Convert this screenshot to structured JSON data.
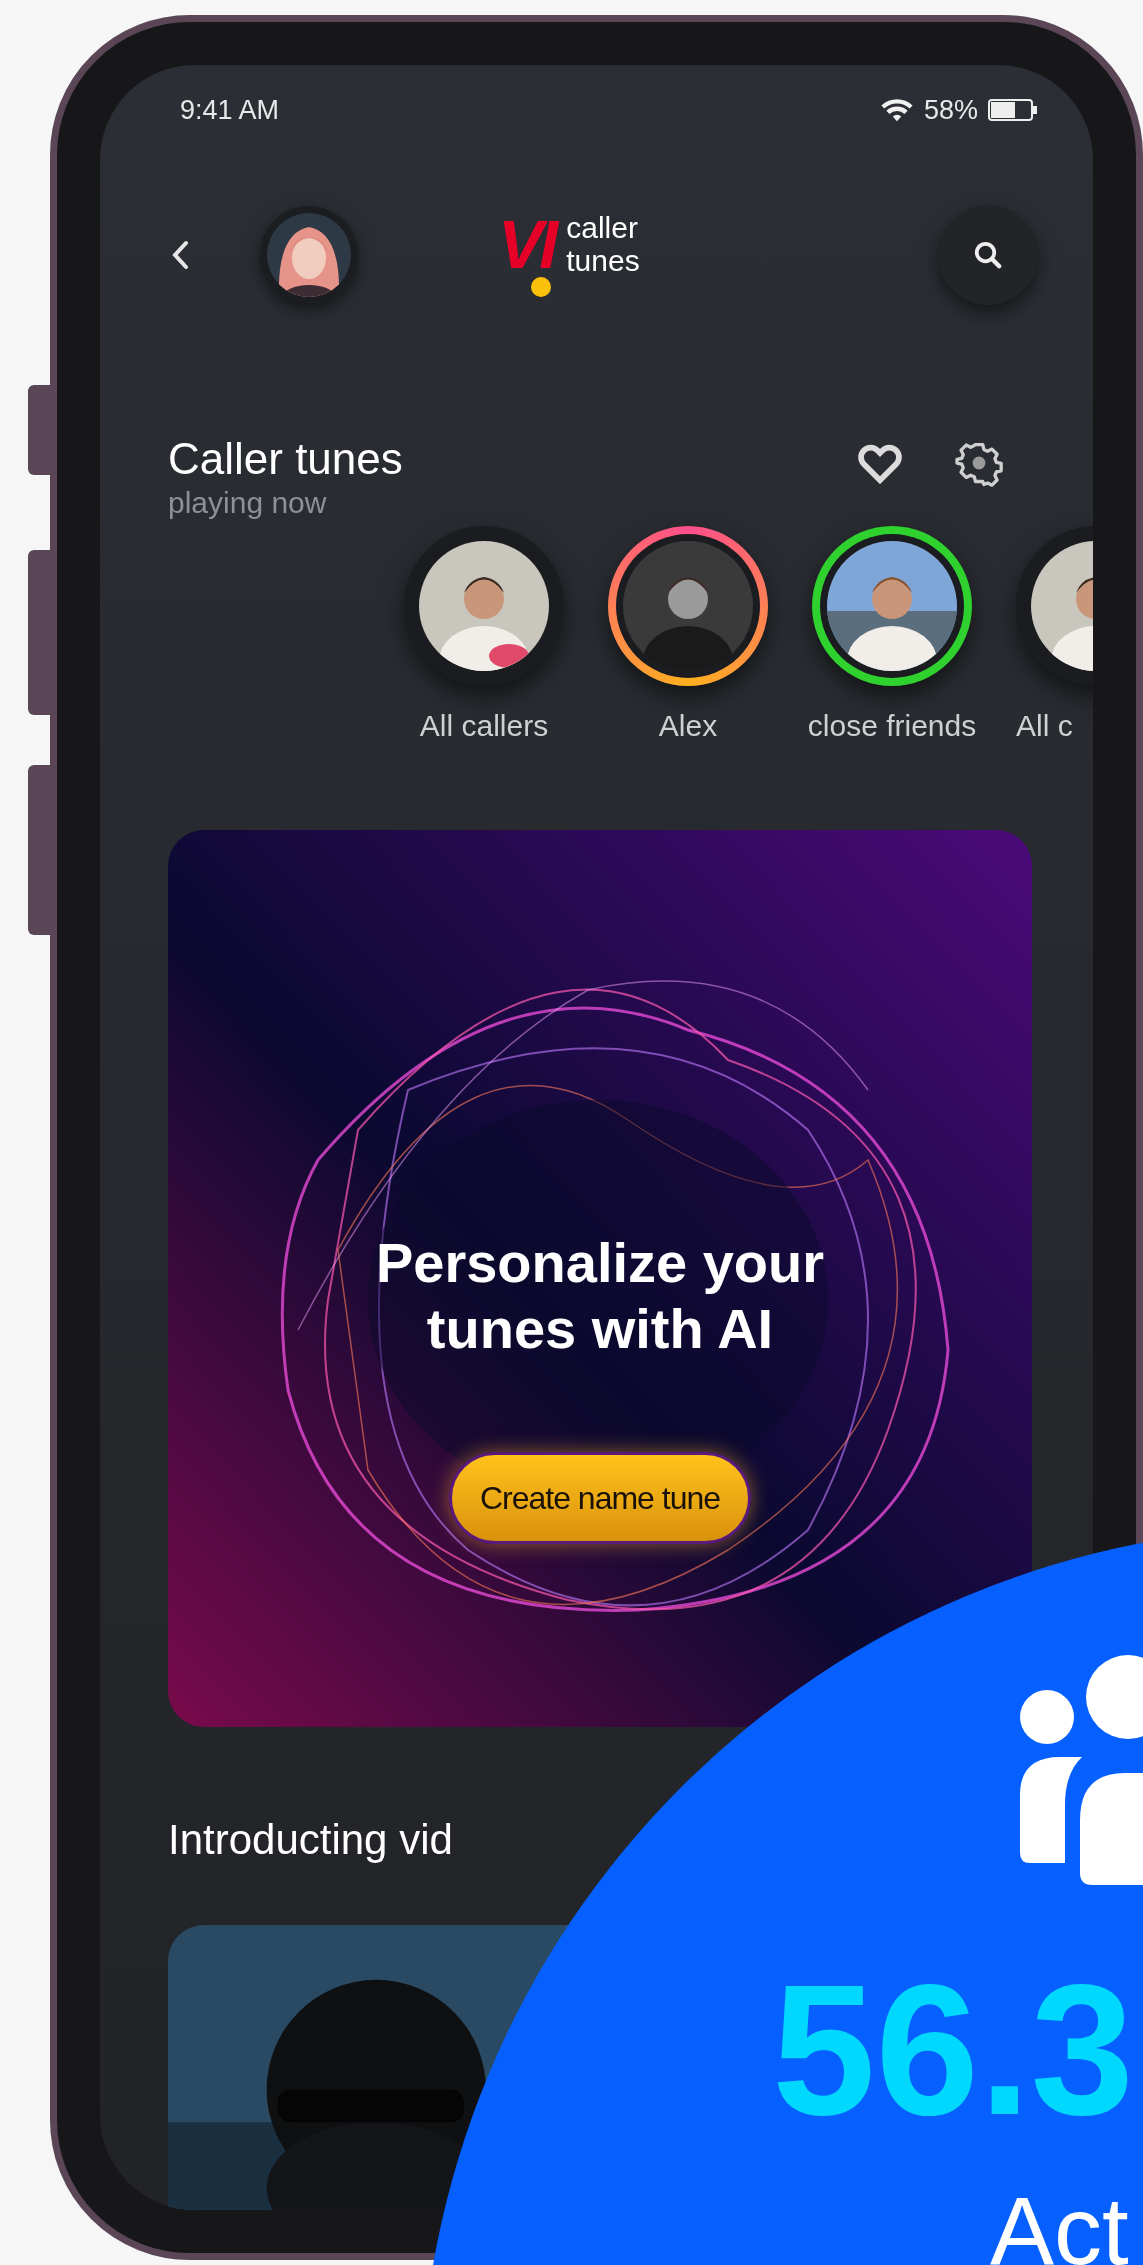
{
  "status_bar": {
    "time": "9:41 AM",
    "battery": "58%"
  },
  "header": {
    "logo": {
      "mark": "VI",
      "caption": [
        "caller",
        "tunes"
      ]
    }
  },
  "section": {
    "title": "Caller tunes",
    "subtitle": "playing now"
  },
  "tunes": [
    {
      "label": "All callers",
      "kind": "plain"
    },
    {
      "label": "Alex",
      "kind": "gradient"
    },
    {
      "label": "close friends",
      "kind": "ring",
      "color": "#2fd12f"
    },
    {
      "label": "All c",
      "kind": "plain"
    }
  ],
  "banner": {
    "title": "Personalize your tunes with AI",
    "button": "Create name tune"
  },
  "videos": {
    "title": "Introducting vid"
  },
  "overlay": {
    "value": "56.3",
    "label": "Act"
  }
}
